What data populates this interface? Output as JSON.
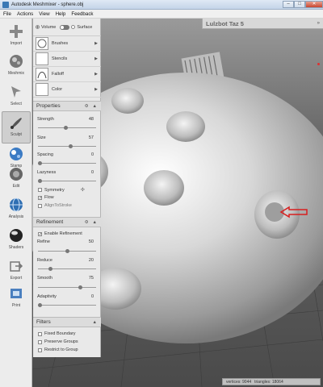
{
  "window": {
    "title": "Autodesk Meshmixer - sphere.obj",
    "min": "–",
    "max": "□",
    "close": "✕"
  },
  "menu": [
    "File",
    "Actions",
    "View",
    "Help",
    "Feedback"
  ],
  "toolbar": [
    {
      "id": "import",
      "label": "Import",
      "icon": "plus-icon"
    },
    {
      "id": "meshmix",
      "label": "Meshmix",
      "icon": "meshmix-icon"
    },
    {
      "id": "select",
      "label": "Select",
      "icon": "arrow-cursor-icon"
    },
    {
      "id": "sculpt",
      "label": "Sculpt",
      "icon": "brush-icon",
      "active": true
    },
    {
      "id": "stamp",
      "label": "Stamp",
      "icon": "stamp-icon"
    },
    {
      "id": "edit",
      "label": "Edit",
      "icon": "edit-icon"
    },
    {
      "id": "analysis",
      "label": "Analysis",
      "icon": "globe-icon"
    },
    {
      "id": "shaders",
      "label": "Shaders",
      "icon": "shader-sphere-icon"
    },
    {
      "id": "export",
      "label": "Export",
      "icon": "export-icon"
    },
    {
      "id": "print",
      "label": "Print",
      "icon": "print-icon"
    }
  ],
  "panel": {
    "mode": {
      "volume": "Volume",
      "surface": "Surface"
    },
    "brushes": "Brushes",
    "stencils": "Stencils",
    "falloff": "Falloff",
    "color": "Color",
    "properties": {
      "title": "Properties",
      "strength": {
        "label": "Strength",
        "value": "48",
        "level": 0.48
      },
      "size": {
        "label": "Size",
        "value": "57",
        "level": 0.57
      },
      "spacing": {
        "label": "Spacing",
        "value": "0",
        "level": 0.0
      },
      "lazyness": {
        "label": "Lazyness",
        "value": "0",
        "level": 0.0
      },
      "symmetry": "Symmetry",
      "flow": "Flow",
      "align": "AlignToStroke"
    },
    "refinement": {
      "title": "Refinement",
      "enable": "Enable Refinement",
      "refine": {
        "label": "Refine",
        "value": "50",
        "level": 0.5
      },
      "reduce": {
        "label": "Reduce",
        "value": "20",
        "level": 0.2
      },
      "smooth": {
        "label": "Smooth",
        "value": "75",
        "level": 0.75
      },
      "adaptivity": {
        "label": "Adaptivity",
        "value": "0",
        "level": 0.0
      }
    },
    "filters": {
      "title": "Filters",
      "fixed": "Fixed Boundary",
      "preserve": "Preserve Groups",
      "restrict": "Restrict to Group"
    }
  },
  "viewport": {
    "printer": "Lulzbot Taz 5",
    "chevron": "»",
    "status": {
      "vertices": "vertices: 9044",
      "triangles": "triangles: 18064"
    }
  }
}
